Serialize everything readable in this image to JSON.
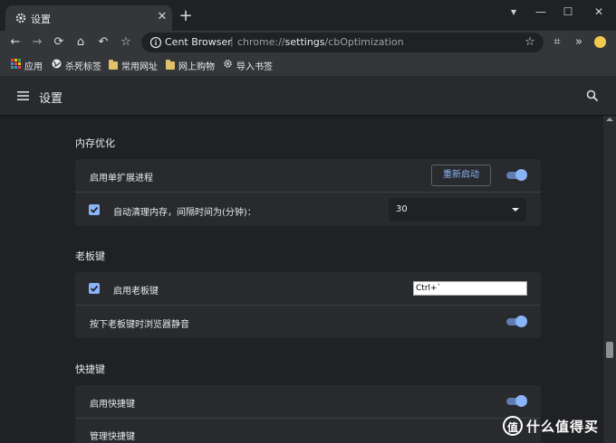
{
  "tab": {
    "title": "设置",
    "close": "✕",
    "new_tab": "+"
  },
  "window": {
    "dropdown": "▾",
    "minimize": "—",
    "maximize": "☐",
    "close": "✕"
  },
  "toolbar": {
    "back": "←",
    "forward": "→",
    "reload": "⟳",
    "home": "⌂",
    "undo": "↶",
    "bookmark_star": "☆",
    "omnibox": {
      "host": "Cent Browser",
      "separator": "|",
      "url_prefix": "chrome://",
      "url_bold": "settings",
      "url_suffix": "/cbOptimization",
      "star": "☆"
    },
    "crop": "⌗",
    "extensions_menu": "»"
  },
  "bookmarks": [
    {
      "label": "应用"
    },
    {
      "label": "杀死标签"
    },
    {
      "label": "常用网址"
    },
    {
      "label": "网上购物"
    },
    {
      "label": "导入书签"
    }
  ],
  "settings": {
    "title": "设置"
  },
  "sections": {
    "memory": {
      "title": "内存优化",
      "single_ext_label": "启用单扩展进程",
      "restart_label": "重新启动",
      "auto_clean_label": "自动清理内存，间隔时间为(分钟)：",
      "interval_value": "30"
    },
    "boss_key": {
      "title": "老板键",
      "enable_label": "启用老板键",
      "hotkey_value": "Ctrl+`",
      "mute_label": "按下老板键时浏览器静音"
    },
    "shortcuts": {
      "title": "快捷键",
      "enable_label": "启用快捷键",
      "manage_label": "管理快捷键"
    }
  },
  "watermark": {
    "mark": "值",
    "text": "什么值得买"
  },
  "colors": {
    "accent": "#8ab4f8",
    "background": "#202124",
    "card": "#292a2d",
    "toolbar": "#35363a"
  }
}
